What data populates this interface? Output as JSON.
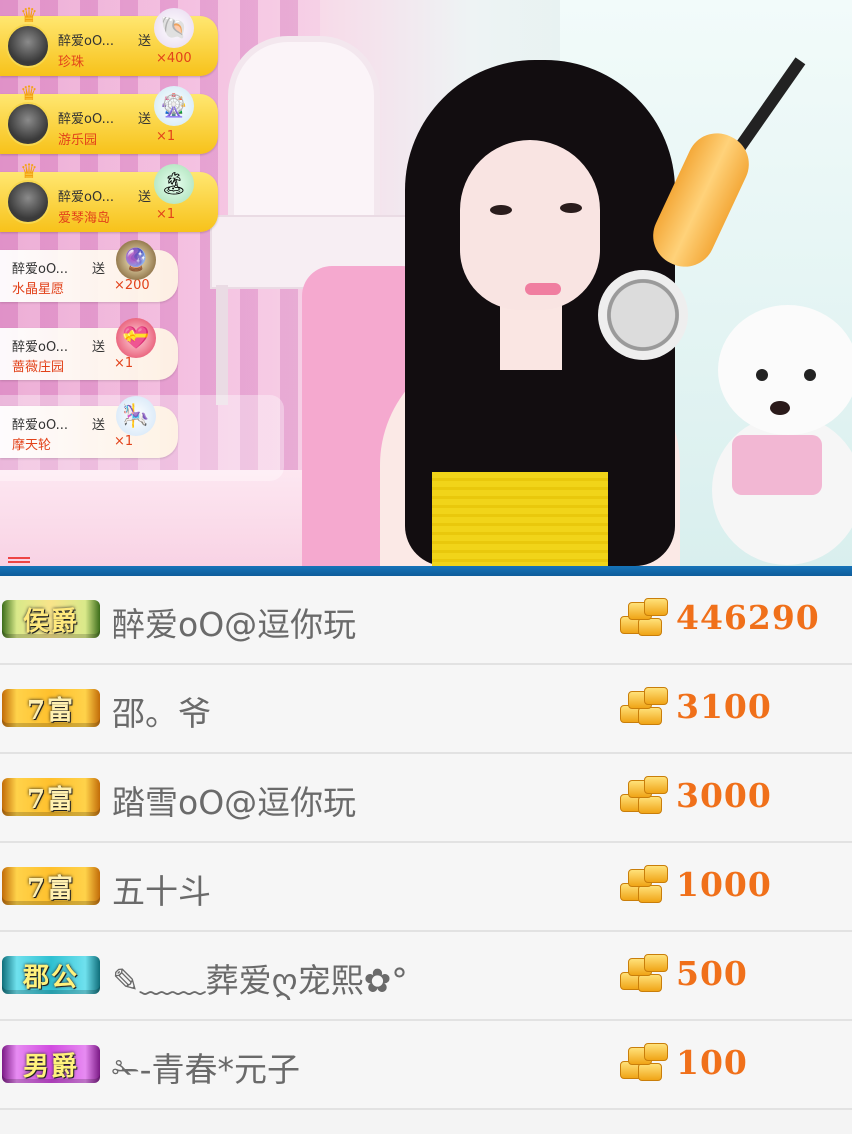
{
  "gift_feed": [
    {
      "sender": "醉爱oO...",
      "action": "送",
      "gift": "珍珠",
      "count": "×400",
      "icon": "pearl-shell-icon",
      "style": "big"
    },
    {
      "sender": "醉爱oO...",
      "action": "送",
      "gift": "游乐园",
      "count": "×1",
      "icon": "amusement-park-icon",
      "style": "big"
    },
    {
      "sender": "醉爱oO...",
      "action": "送",
      "gift": "爱琴海岛",
      "count": "×1",
      "icon": "island-icon",
      "style": "big"
    },
    {
      "sender": "醉爱oO...",
      "action": "送",
      "gift": "水晶星愿",
      "count": "×200",
      "icon": "crystal-ball-icon",
      "style": "small"
    },
    {
      "sender": "醉爱oO...",
      "action": "送",
      "gift": "蔷薇庄园",
      "count": "×1",
      "icon": "rose-heart-icon",
      "style": "small"
    },
    {
      "sender": "醉爱oO...",
      "action": "送",
      "gift": "摩天轮",
      "count": "×1",
      "icon": "ferris-wheel-icon",
      "style": "small"
    }
  ],
  "ranking": [
    {
      "badge": "侯爵",
      "badge_type": "hou",
      "user": "醉爱oO@逗你玩",
      "amount": "446290"
    },
    {
      "badge": "7富",
      "badge_type": "gong",
      "user": "邵。爷",
      "amount": "3100"
    },
    {
      "badge": "7富",
      "badge_type": "gong",
      "user": "踏雪oO@逗你玩",
      "amount": "3000"
    },
    {
      "badge": "7富",
      "badge_type": "gong",
      "user": "五十斗",
      "amount": "1000"
    },
    {
      "badge": "郡公",
      "badge_type": "jun",
      "user": "✎﹏﹏葬爱ღ宠熙✿°",
      "amount": "500"
    },
    {
      "badge": "男爵",
      "badge_type": "nan",
      "user": "✁-青春*元子",
      "amount": "100"
    }
  ],
  "colors": {
    "divider": "#1673b8",
    "amount": "#f0701a",
    "gift_banner": "#f7c21a"
  }
}
